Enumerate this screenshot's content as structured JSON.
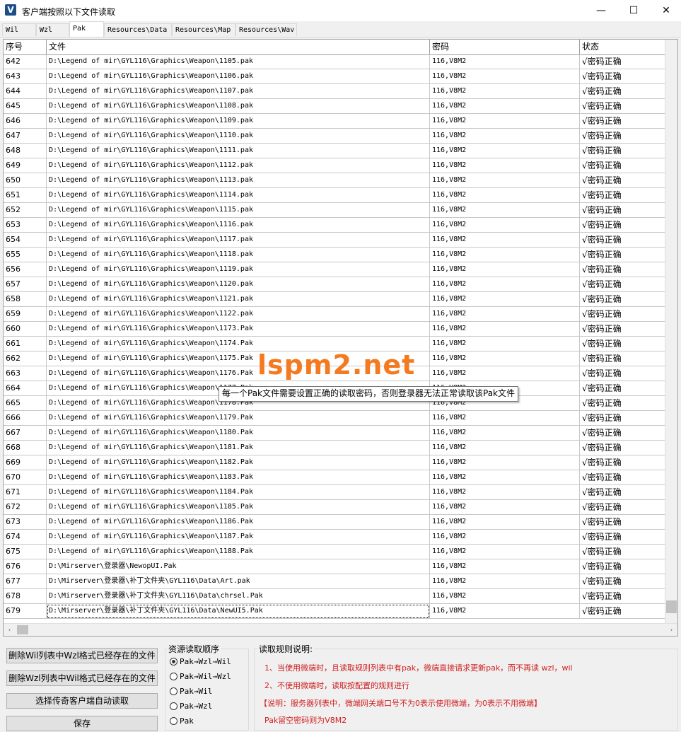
{
  "window": {
    "title": "客户端按照以下文件读取",
    "icon_letter": "V",
    "controls": {
      "minimize": "—",
      "maximize": "☐",
      "close": "✕"
    }
  },
  "tabs": [
    {
      "label": "Wil"
    },
    {
      "label": "Wzl"
    },
    {
      "label": "Pak"
    },
    {
      "label": "Resources\\Data"
    },
    {
      "label": "Resources\\Map"
    },
    {
      "label": "Resources\\Wav"
    }
  ],
  "active_tab": "Pak",
  "table": {
    "headers": {
      "index": "序号",
      "file": "文件",
      "password": "密码",
      "status": "状态"
    },
    "rows": [
      {
        "index": "642",
        "file": "D:\\Legend of mir\\GYL116\\Graphics\\Weapon\\1105.pak",
        "password": "116,V8M2",
        "status": "√密码正确"
      },
      {
        "index": "643",
        "file": "D:\\Legend of mir\\GYL116\\Graphics\\Weapon\\1106.pak",
        "password": "116,V8M2",
        "status": "√密码正确"
      },
      {
        "index": "644",
        "file": "D:\\Legend of mir\\GYL116\\Graphics\\Weapon\\1107.pak",
        "password": "116,V8M2",
        "status": "√密码正确"
      },
      {
        "index": "645",
        "file": "D:\\Legend of mir\\GYL116\\Graphics\\Weapon\\1108.pak",
        "password": "116,V8M2",
        "status": "√密码正确"
      },
      {
        "index": "646",
        "file": "D:\\Legend of mir\\GYL116\\Graphics\\Weapon\\1109.pak",
        "password": "116,V8M2",
        "status": "√密码正确"
      },
      {
        "index": "647",
        "file": "D:\\Legend of mir\\GYL116\\Graphics\\Weapon\\1110.pak",
        "password": "116,V8M2",
        "status": "√密码正确"
      },
      {
        "index": "648",
        "file": "D:\\Legend of mir\\GYL116\\Graphics\\Weapon\\1111.pak",
        "password": "116,V8M2",
        "status": "√密码正确"
      },
      {
        "index": "649",
        "file": "D:\\Legend of mir\\GYL116\\Graphics\\Weapon\\1112.pak",
        "password": "116,V8M2",
        "status": "√密码正确"
      },
      {
        "index": "650",
        "file": "D:\\Legend of mir\\GYL116\\Graphics\\Weapon\\1113.pak",
        "password": "116,V8M2",
        "status": "√密码正确"
      },
      {
        "index": "651",
        "file": "D:\\Legend of mir\\GYL116\\Graphics\\Weapon\\1114.pak",
        "password": "116,V8M2",
        "status": "√密码正确"
      },
      {
        "index": "652",
        "file": "D:\\Legend of mir\\GYL116\\Graphics\\Weapon\\1115.pak",
        "password": "116,V8M2",
        "status": "√密码正确"
      },
      {
        "index": "653",
        "file": "D:\\Legend of mir\\GYL116\\Graphics\\Weapon\\1116.pak",
        "password": "116,V8M2",
        "status": "√密码正确"
      },
      {
        "index": "654",
        "file": "D:\\Legend of mir\\GYL116\\Graphics\\Weapon\\1117.pak",
        "password": "116,V8M2",
        "status": "√密码正确"
      },
      {
        "index": "655",
        "file": "D:\\Legend of mir\\GYL116\\Graphics\\Weapon\\1118.pak",
        "password": "116,V8M2",
        "status": "√密码正确"
      },
      {
        "index": "656",
        "file": "D:\\Legend of mir\\GYL116\\Graphics\\Weapon\\1119.pak",
        "password": "116,V8M2",
        "status": "√密码正确"
      },
      {
        "index": "657",
        "file": "D:\\Legend of mir\\GYL116\\Graphics\\Weapon\\1120.pak",
        "password": "116,V8M2",
        "status": "√密码正确"
      },
      {
        "index": "658",
        "file": "D:\\Legend of mir\\GYL116\\Graphics\\Weapon\\1121.pak",
        "password": "116,V8M2",
        "status": "√密码正确"
      },
      {
        "index": "659",
        "file": "D:\\Legend of mir\\GYL116\\Graphics\\Weapon\\1122.pak",
        "password": "116,V8M2",
        "status": "√密码正确"
      },
      {
        "index": "660",
        "file": "D:\\Legend of mir\\GYL116\\Graphics\\Weapon\\1173.Pak",
        "password": "116,V8M2",
        "status": "√密码正确"
      },
      {
        "index": "661",
        "file": "D:\\Legend of mir\\GYL116\\Graphics\\Weapon\\1174.Pak",
        "password": "116,V8M2",
        "status": "√密码正确"
      },
      {
        "index": "662",
        "file": "D:\\Legend of mir\\GYL116\\Graphics\\Weapon\\1175.Pak",
        "password": "116,V8M2",
        "status": "√密码正确"
      },
      {
        "index": "663",
        "file": "D:\\Legend of mir\\GYL116\\Graphics\\Weapon\\1176.Pak",
        "password": "116,V8M2",
        "status": "√密码正确"
      },
      {
        "index": "664",
        "file": "D:\\Legend of mir\\GYL116\\Graphics\\Weapon\\1177.Pak",
        "password": "116,V8M2",
        "status": "√密码正确"
      },
      {
        "index": "665",
        "file": "D:\\Legend of mir\\GYL116\\Graphics\\Weapon\\1178.Pak",
        "password": "116,V8M2",
        "status": "√密码正确"
      },
      {
        "index": "666",
        "file": "D:\\Legend of mir\\GYL116\\Graphics\\Weapon\\1179.Pak",
        "password": "116,V8M2",
        "status": "√密码正确"
      },
      {
        "index": "667",
        "file": "D:\\Legend of mir\\GYL116\\Graphics\\Weapon\\1180.Pak",
        "password": "116,V8M2",
        "status": "√密码正确"
      },
      {
        "index": "668",
        "file": "D:\\Legend of mir\\GYL116\\Graphics\\Weapon\\1181.Pak",
        "password": "116,V8M2",
        "status": "√密码正确"
      },
      {
        "index": "669",
        "file": "D:\\Legend of mir\\GYL116\\Graphics\\Weapon\\1182.Pak",
        "password": "116,V8M2",
        "status": "√密码正确"
      },
      {
        "index": "670",
        "file": "D:\\Legend of mir\\GYL116\\Graphics\\Weapon\\1183.Pak",
        "password": "116,V8M2",
        "status": "√密码正确"
      },
      {
        "index": "671",
        "file": "D:\\Legend of mir\\GYL116\\Graphics\\Weapon\\1184.Pak",
        "password": "116,V8M2",
        "status": "√密码正确"
      },
      {
        "index": "672",
        "file": "D:\\Legend of mir\\GYL116\\Graphics\\Weapon\\1185.Pak",
        "password": "116,V8M2",
        "status": "√密码正确"
      },
      {
        "index": "673",
        "file": "D:\\Legend of mir\\GYL116\\Graphics\\Weapon\\1186.Pak",
        "password": "116,V8M2",
        "status": "√密码正确"
      },
      {
        "index": "674",
        "file": "D:\\Legend of mir\\GYL116\\Graphics\\Weapon\\1187.Pak",
        "password": "116,V8M2",
        "status": "√密码正确"
      },
      {
        "index": "675",
        "file": "D:\\Legend of mir\\GYL116\\Graphics\\Weapon\\1188.Pak",
        "password": "116,V8M2",
        "status": "√密码正确"
      },
      {
        "index": "676",
        "file": "D:\\Mirserver\\登录器\\NewopUI.Pak",
        "password": "116,V8M2",
        "status": "√密码正确"
      },
      {
        "index": "677",
        "file": "D:\\Mirserver\\登录器\\补丁文件夹\\GYL116\\Data\\Art.pak",
        "password": "116,V8M2",
        "status": "√密码正确"
      },
      {
        "index": "678",
        "file": "D:\\Mirserver\\登录器\\补丁文件夹\\GYL116\\Data\\chrsel.Pak",
        "password": "116,V8M2",
        "status": "√密码正确"
      },
      {
        "index": "679",
        "file": "D:\\Mirserver\\登录器\\补丁文件夹\\GYL116\\Data\\NewUI5.Pak",
        "password": "116,V8M2",
        "status": "√密码正确"
      }
    ]
  },
  "scroll": {
    "left_arrow": "‹",
    "right_arrow": "›"
  },
  "watermark": "lspm2.net",
  "tooltip": "每一个Pak文件需要设置正确的读取密码，否则登录器无法正常读取该Pak文件",
  "buttons": {
    "delete_wil": "删除Wil列表中Wzl格式已经存在的文件",
    "delete_wzl": "删除Wzl列表中Wil格式已经存在的文件",
    "auto_read": "选择传奇客户端自动读取",
    "save": "保存"
  },
  "order_group": {
    "title": "资源读取顺序",
    "options": [
      "Pak→Wzl→Wil",
      "Pak→Wil→Wzl",
      "Pak→Wil",
      "Pak→Wzl",
      "Pak"
    ],
    "selected_index": 0
  },
  "rules": {
    "title": "读取规则说明:",
    "lines": [
      "1、当使用微端时，且读取规则列表中有pak，微端直接请求更新pak，而不再读 wzl，wil",
      "2、不使用微端时，读取按配置的规则进行",
      "【说明：服务器列表中，微端网关端口号不为0表示使用微端，为0表示不用微端】",
      "Pak留空密码则为V8M2"
    ]
  }
}
